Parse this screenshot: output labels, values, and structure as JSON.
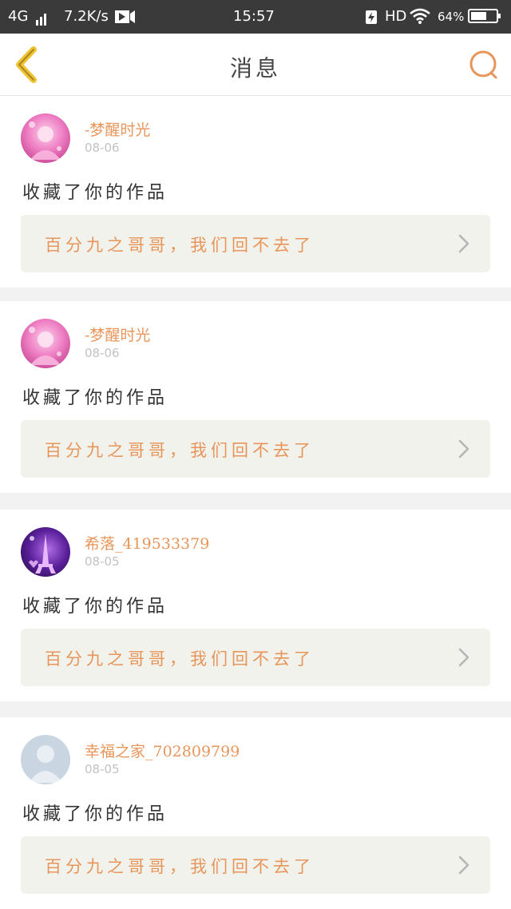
{
  "status_bar": {
    "network": "4G",
    "speed": "7.2K/s",
    "time": "15:57",
    "hd": "HD",
    "battery_percent": "64%",
    "battery_level": 0.64
  },
  "header": {
    "title": "消息",
    "back_icon": "chevron-left-icon",
    "search_icon": "search-icon",
    "accent_color": "#e8955a",
    "back_color": "#f1c232"
  },
  "messages": [
    {
      "avatar": "pink-anime-girl-avatar",
      "username": "-梦醒时光",
      "date": "08-06",
      "action": "收藏了你的作品",
      "work_title": "百分九之哥哥，我们回不去了"
    },
    {
      "avatar": "pink-anime-girl-avatar",
      "username": "-梦醒时光",
      "date": "08-06",
      "action": "收藏了你的作品",
      "work_title": "百分九之哥哥，我们回不去了"
    },
    {
      "avatar": "purple-eiffel-tower-avatar",
      "username": "希落_419533379",
      "date": "08-05",
      "action": "收藏了你的作品",
      "work_title": "百分九之哥哥，我们回不去了"
    },
    {
      "avatar": "default-user-avatar",
      "username": "幸福之家_702809799",
      "date": "08-05",
      "action": "收藏了你的作品",
      "work_title": "百分九之哥哥，我们回不去了"
    }
  ]
}
